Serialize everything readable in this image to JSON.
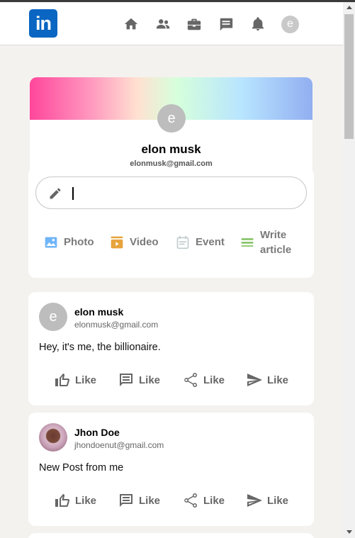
{
  "header": {
    "logo_text": "in",
    "nav_icons": [
      "home-icon",
      "network-icon",
      "jobs-icon",
      "messaging-icon",
      "notifications-icon"
    ],
    "avatar_initial": "e"
  },
  "profile": {
    "avatar_initial": "e",
    "name": "elon musk",
    "email": "elonmusk@gmail.com"
  },
  "share": {
    "input_value": "",
    "options": [
      {
        "label": "Photo",
        "icon": "photo-icon",
        "color": "#70b5f9"
      },
      {
        "label": "Video",
        "icon": "video-icon",
        "color": "#e7a33e"
      },
      {
        "label": "Event",
        "icon": "event-icon",
        "color": "#c0cbcd"
      },
      {
        "label": "Write article",
        "line1": "Write",
        "line2": "article",
        "icon": "article-icon",
        "color": "#7fc15e"
      }
    ]
  },
  "posts": [
    {
      "avatar_initial": "e",
      "name": "elon musk",
      "email": "elonmusk@gmail.com",
      "message": "Hey, it's me, the billionaire.",
      "actions": [
        "Like",
        "Like",
        "Like",
        "Like"
      ]
    },
    {
      "avatar_initial": "",
      "name": "Jhon Doe",
      "email": "jhondoenut@gmail.com",
      "message": "New Post from me",
      "actions": [
        "Like",
        "Like",
        "Like",
        "Like"
      ]
    }
  ]
}
